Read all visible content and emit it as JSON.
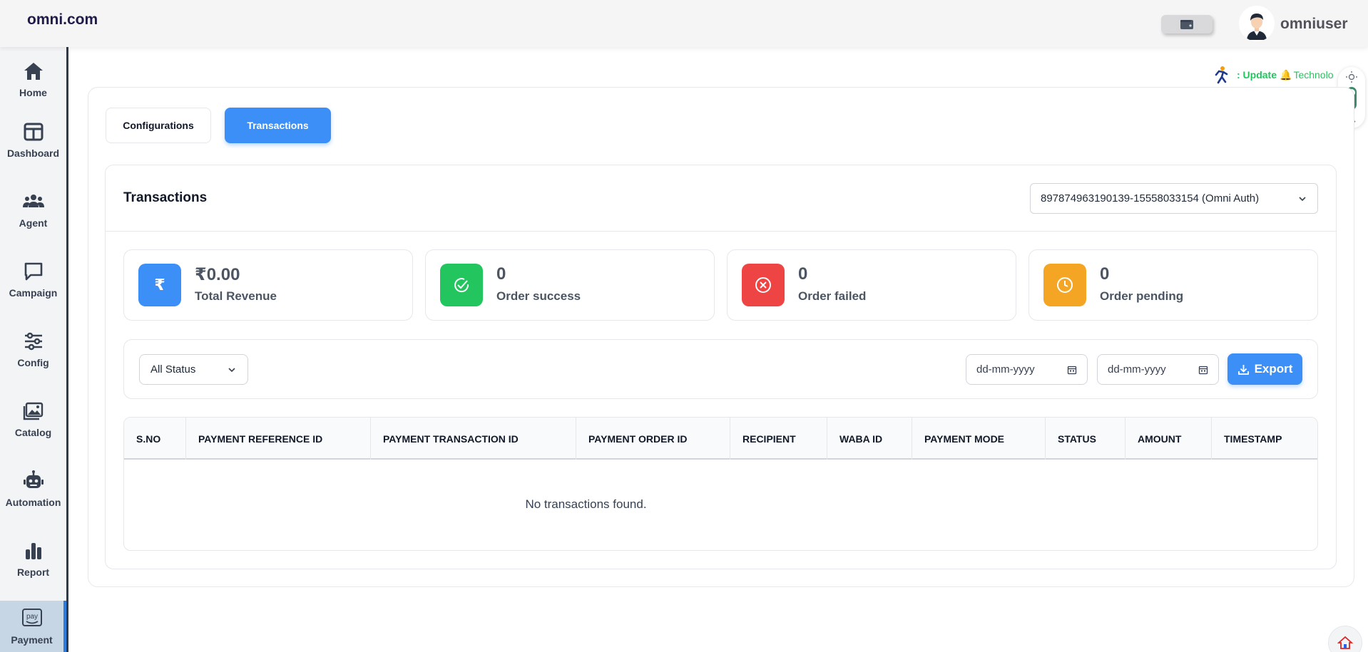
{
  "header": {
    "brand": "omni.com",
    "username": "omniuser"
  },
  "sidebar": {
    "items": [
      {
        "label": "Home",
        "icon": "home-icon"
      },
      {
        "label": "Dashboard",
        "icon": "dashboard-icon"
      },
      {
        "label": "Agent",
        "icon": "agent-icon"
      },
      {
        "label": "Campaign",
        "icon": "chat-icon"
      },
      {
        "label": "Config",
        "icon": "sliders-icon"
      },
      {
        "label": "Catalog",
        "icon": "image-icon"
      },
      {
        "label": "Automation",
        "icon": "robot-icon"
      },
      {
        "label": "Report",
        "icon": "bar-chart-icon"
      },
      {
        "label": "Payment",
        "icon": "amazon-pay-icon",
        "icon_text": "pay",
        "active": true
      }
    ]
  },
  "banner": {
    "prefix": ": Update",
    "text": "Technolo"
  },
  "tabs": [
    {
      "label": "Configurations",
      "active": false
    },
    {
      "label": "Transactions",
      "active": true
    }
  ],
  "transactions": {
    "title": "Transactions",
    "account": "897874963190139-15558033154 (Omni Auth)",
    "stats": [
      {
        "value": "₹0.00",
        "label": "Total Revenue",
        "color": "#3b8ff6",
        "icon": "rupee-icon"
      },
      {
        "value": "0",
        "label": "Order success",
        "color": "#22c55e",
        "icon": "check-circle-icon"
      },
      {
        "value": "0",
        "label": "Order failed",
        "color": "#ef4444",
        "icon": "x-circle-icon"
      },
      {
        "value": "0",
        "label": "Order pending",
        "color": "#f5a524",
        "icon": "clock-icon"
      }
    ],
    "filters": {
      "status": "All Status",
      "from_placeholder": "dd-mm-yyyy",
      "to_placeholder": "dd-mm-yyyy",
      "export_label": "Export"
    },
    "table": {
      "columns": [
        "S.NO",
        "PAYMENT REFERENCE ID",
        "PAYMENT TRANSACTION ID",
        "PAYMENT ORDER ID",
        "RECIPIENT",
        "WABA ID",
        "PAYMENT MODE",
        "STATUS",
        "AMOUNT",
        "TIMESTAMP"
      ],
      "empty_message": "No transactions found."
    }
  }
}
